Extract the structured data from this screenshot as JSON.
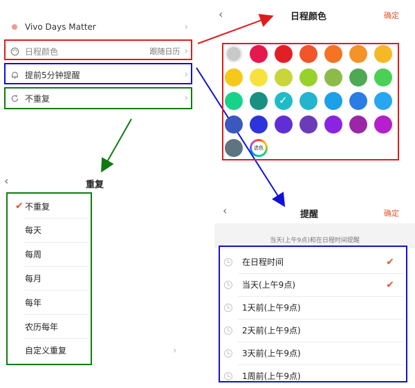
{
  "settings": {
    "calendar_name": "Vivo Days Matter",
    "color_label": "日程颜色",
    "color_value": "跟随日历",
    "reminder_label": "提前5分钟提醒",
    "repeat_label": "不重复"
  },
  "repeat_panel": {
    "title": "重复",
    "selected_index": 0,
    "options": [
      "不重复",
      "每天",
      "每周",
      "每月",
      "每年",
      "农历每年",
      "自定义重复"
    ]
  },
  "color_panel": {
    "title": "日程颜色",
    "confirm": "确定",
    "custom_label": "选色",
    "selected_index": 16,
    "colors": [
      "#c9c9c9",
      "#e5194d",
      "#e31f26",
      "#f0562a",
      "#f47424",
      "#f5922a",
      "#f5b928",
      "#f5c81b",
      "#f7e13e",
      "#c8d63c",
      "#97d22b",
      "#8dbb49",
      "#4ea952",
      "#4ad054",
      "#19d289",
      "#1a9083",
      "#1fbcc8",
      "#23b4cf",
      "#1ca0e8",
      "#2c7ce5",
      "#29a6f0",
      "#3b58bd",
      "#2c35dc",
      "#5f2fd5",
      "#6b3bb8",
      "#8b24e0",
      "#9b27a8",
      "#b51fcc",
      "#5f7480"
    ]
  },
  "reminder_panel": {
    "title": "提醒",
    "confirm": "确定",
    "hint": "当天(上午9点)和在日程时间提醒",
    "options": [
      {
        "label": "在日程时间",
        "checked": true
      },
      {
        "label": "当天(上午9点)",
        "checked": true
      },
      {
        "label": "1天前(上午9点)",
        "checked": false
      },
      {
        "label": "2天前(上午9点)",
        "checked": false
      },
      {
        "label": "3天前(上午9点)",
        "checked": false
      },
      {
        "label": "1周前(上午9点)",
        "checked": false
      }
    ]
  },
  "colors": {
    "accent": "#e3562c",
    "annotation_red": "#e01b1b",
    "annotation_blue": "#1010d8",
    "annotation_green": "#107a10"
  }
}
